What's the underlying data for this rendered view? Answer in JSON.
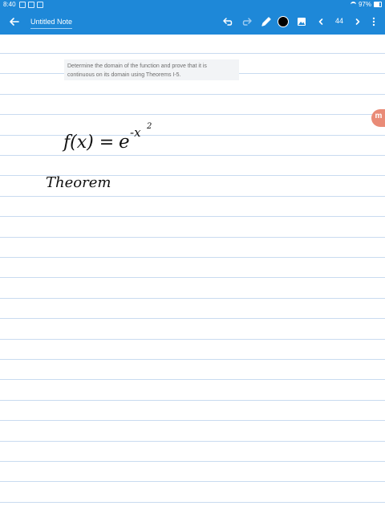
{
  "status_bar": {
    "time": "8:40",
    "battery": "97%"
  },
  "toolbar": {
    "title": "Untitled Note",
    "page": "44",
    "icons": [
      "back-arrow-icon",
      "undo-icon",
      "redo-icon",
      "pen-icon",
      "color-swatch",
      "image-icon",
      "chevron-left-icon",
      "chevron-right-icon",
      "more-vert-icon"
    ],
    "pen_color": "#000000",
    "accent_color": "#1e88d8"
  },
  "question": {
    "line1": "Determine the domain of the function and prove that it is",
    "line2": "continuous on its domain using Theorems I-5."
  },
  "handwriting": {
    "lhs": "f(x) =",
    "base": "e",
    "exponent": "-x",
    "power": "2",
    "word": "Theorem"
  },
  "logo": {
    "letter": "m"
  }
}
